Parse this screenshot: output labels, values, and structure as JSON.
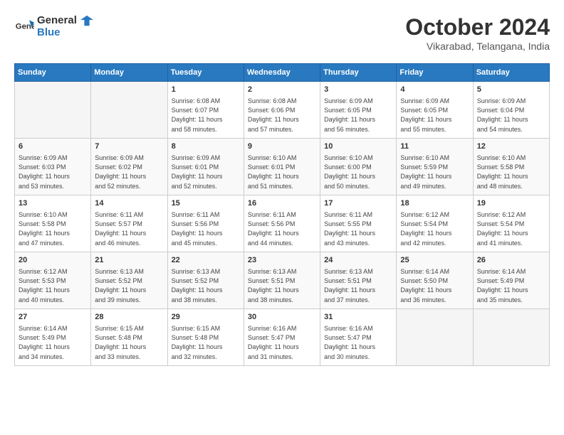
{
  "header": {
    "logo_line1": "General",
    "logo_line2": "Blue",
    "month": "October 2024",
    "location": "Vikarabad, Telangana, India"
  },
  "weekdays": [
    "Sunday",
    "Monday",
    "Tuesday",
    "Wednesday",
    "Thursday",
    "Friday",
    "Saturday"
  ],
  "weeks": [
    [
      {
        "day": "",
        "info": ""
      },
      {
        "day": "",
        "info": ""
      },
      {
        "day": "1",
        "info": "Sunrise: 6:08 AM\nSunset: 6:07 PM\nDaylight: 11 hours\nand 58 minutes."
      },
      {
        "day": "2",
        "info": "Sunrise: 6:08 AM\nSunset: 6:06 PM\nDaylight: 11 hours\nand 57 minutes."
      },
      {
        "day": "3",
        "info": "Sunrise: 6:09 AM\nSunset: 6:05 PM\nDaylight: 11 hours\nand 56 minutes."
      },
      {
        "day": "4",
        "info": "Sunrise: 6:09 AM\nSunset: 6:05 PM\nDaylight: 11 hours\nand 55 minutes."
      },
      {
        "day": "5",
        "info": "Sunrise: 6:09 AM\nSunset: 6:04 PM\nDaylight: 11 hours\nand 54 minutes."
      }
    ],
    [
      {
        "day": "6",
        "info": "Sunrise: 6:09 AM\nSunset: 6:03 PM\nDaylight: 11 hours\nand 53 minutes."
      },
      {
        "day": "7",
        "info": "Sunrise: 6:09 AM\nSunset: 6:02 PM\nDaylight: 11 hours\nand 52 minutes."
      },
      {
        "day": "8",
        "info": "Sunrise: 6:09 AM\nSunset: 6:01 PM\nDaylight: 11 hours\nand 52 minutes."
      },
      {
        "day": "9",
        "info": "Sunrise: 6:10 AM\nSunset: 6:01 PM\nDaylight: 11 hours\nand 51 minutes."
      },
      {
        "day": "10",
        "info": "Sunrise: 6:10 AM\nSunset: 6:00 PM\nDaylight: 11 hours\nand 50 minutes."
      },
      {
        "day": "11",
        "info": "Sunrise: 6:10 AM\nSunset: 5:59 PM\nDaylight: 11 hours\nand 49 minutes."
      },
      {
        "day": "12",
        "info": "Sunrise: 6:10 AM\nSunset: 5:58 PM\nDaylight: 11 hours\nand 48 minutes."
      }
    ],
    [
      {
        "day": "13",
        "info": "Sunrise: 6:10 AM\nSunset: 5:58 PM\nDaylight: 11 hours\nand 47 minutes."
      },
      {
        "day": "14",
        "info": "Sunrise: 6:11 AM\nSunset: 5:57 PM\nDaylight: 11 hours\nand 46 minutes."
      },
      {
        "day": "15",
        "info": "Sunrise: 6:11 AM\nSunset: 5:56 PM\nDaylight: 11 hours\nand 45 minutes."
      },
      {
        "day": "16",
        "info": "Sunrise: 6:11 AM\nSunset: 5:56 PM\nDaylight: 11 hours\nand 44 minutes."
      },
      {
        "day": "17",
        "info": "Sunrise: 6:11 AM\nSunset: 5:55 PM\nDaylight: 11 hours\nand 43 minutes."
      },
      {
        "day": "18",
        "info": "Sunrise: 6:12 AM\nSunset: 5:54 PM\nDaylight: 11 hours\nand 42 minutes."
      },
      {
        "day": "19",
        "info": "Sunrise: 6:12 AM\nSunset: 5:54 PM\nDaylight: 11 hours\nand 41 minutes."
      }
    ],
    [
      {
        "day": "20",
        "info": "Sunrise: 6:12 AM\nSunset: 5:53 PM\nDaylight: 11 hours\nand 40 minutes."
      },
      {
        "day": "21",
        "info": "Sunrise: 6:13 AM\nSunset: 5:52 PM\nDaylight: 11 hours\nand 39 minutes."
      },
      {
        "day": "22",
        "info": "Sunrise: 6:13 AM\nSunset: 5:52 PM\nDaylight: 11 hours\nand 38 minutes."
      },
      {
        "day": "23",
        "info": "Sunrise: 6:13 AM\nSunset: 5:51 PM\nDaylight: 11 hours\nand 38 minutes."
      },
      {
        "day": "24",
        "info": "Sunrise: 6:13 AM\nSunset: 5:51 PM\nDaylight: 11 hours\nand 37 minutes."
      },
      {
        "day": "25",
        "info": "Sunrise: 6:14 AM\nSunset: 5:50 PM\nDaylight: 11 hours\nand 36 minutes."
      },
      {
        "day": "26",
        "info": "Sunrise: 6:14 AM\nSunset: 5:49 PM\nDaylight: 11 hours\nand 35 minutes."
      }
    ],
    [
      {
        "day": "27",
        "info": "Sunrise: 6:14 AM\nSunset: 5:49 PM\nDaylight: 11 hours\nand 34 minutes."
      },
      {
        "day": "28",
        "info": "Sunrise: 6:15 AM\nSunset: 5:48 PM\nDaylight: 11 hours\nand 33 minutes."
      },
      {
        "day": "29",
        "info": "Sunrise: 6:15 AM\nSunset: 5:48 PM\nDaylight: 11 hours\nand 32 minutes."
      },
      {
        "day": "30",
        "info": "Sunrise: 6:16 AM\nSunset: 5:47 PM\nDaylight: 11 hours\nand 31 minutes."
      },
      {
        "day": "31",
        "info": "Sunrise: 6:16 AM\nSunset: 5:47 PM\nDaylight: 11 hours\nand 30 minutes."
      },
      {
        "day": "",
        "info": ""
      },
      {
        "day": "",
        "info": ""
      }
    ]
  ]
}
